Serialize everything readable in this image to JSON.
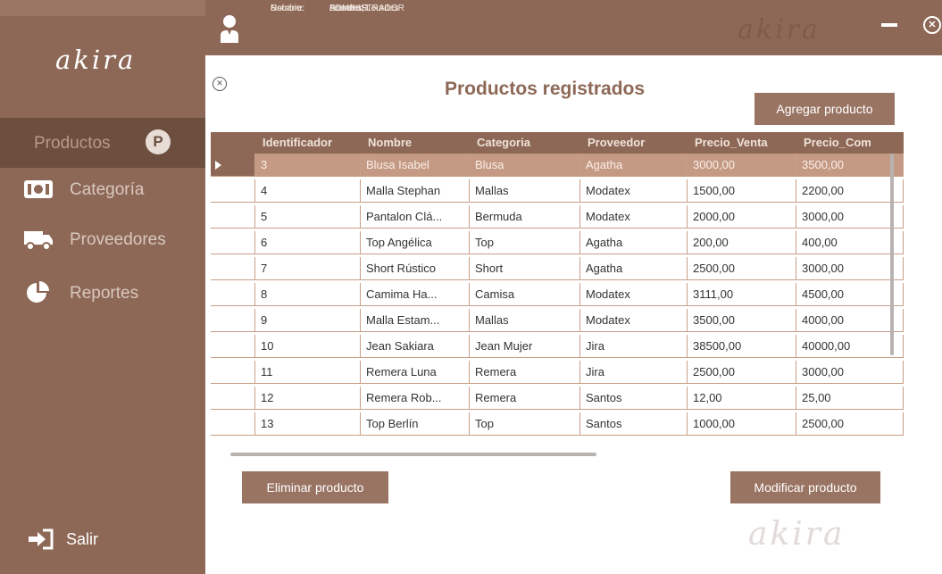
{
  "app": {
    "logo": "akira",
    "watermark": "akira"
  },
  "user": {
    "rol_label": "Rol:",
    "rol": "ADMINISTRADOR",
    "nombre_label": "Nombre:",
    "nombre": "Romera, Lourdes",
    "usuario_label": "Usuario:",
    "usuario": "LourdesR"
  },
  "sidebar": {
    "items": [
      {
        "label": "Productos",
        "badge": "P",
        "icon": "products-icon",
        "active": true
      },
      {
        "label": "Categoría",
        "icon": "category-icon",
        "active": false
      },
      {
        "label": "Proveedores",
        "icon": "truck-icon",
        "active": false
      },
      {
        "label": "Reportes",
        "icon": "pie-chart-icon",
        "active": false
      }
    ],
    "exit_label": "Salir"
  },
  "main": {
    "title": "Productos registrados",
    "add_button": "Agregar producto",
    "delete_button": "Eliminar producto",
    "modify_button": "Modificar producto"
  },
  "table": {
    "columns": [
      "Identificador",
      "Nombre",
      "Categoria",
      "Proveedor",
      "Precio_Venta",
      "Precio_Com"
    ],
    "rows": [
      [
        "3",
        "Blusa Isabel",
        "Blusa",
        "Agatha",
        "3000,00",
        "3500,00"
      ],
      [
        "4",
        "Malla Stephan",
        "Mallas",
        "Modatex",
        "1500,00",
        "2200,00"
      ],
      [
        "5",
        "Pantalon Clá...",
        "Bermuda",
        "Modatex",
        "2000,00",
        "3000,00"
      ],
      [
        "6",
        "Top Angélica",
        "Top",
        "Agatha",
        "200,00",
        "400,00"
      ],
      [
        "7",
        "Short Rústico",
        "Short",
        "Agatha",
        "2500,00",
        "3000,00"
      ],
      [
        "8",
        "Camima Ha...",
        "Camisa",
        "Modatex",
        "3111,00",
        "4500,00"
      ],
      [
        "9",
        "Malla Estam...",
        "Mallas",
        "Modatex",
        "3500,00",
        "4000,00"
      ],
      [
        "10",
        "Jean Sakiara",
        "Jean Mujer",
        "Jira",
        "38500,00",
        "40000,00"
      ],
      [
        "11",
        "Remera Luna",
        "Remera",
        "Jira",
        "2500,00",
        "3000,00"
      ],
      [
        "12",
        "Remera Rob...",
        "Remera",
        "Santos",
        "12,00",
        "25,00"
      ],
      [
        "13",
        "Top Berlín",
        "Top",
        "Santos",
        "1000,00",
        "2500,00"
      ]
    ],
    "selected_index": 0
  },
  "colors": {
    "brand": "#8d6856",
    "selected_row": "#c49a85",
    "button": "#9a7463"
  }
}
